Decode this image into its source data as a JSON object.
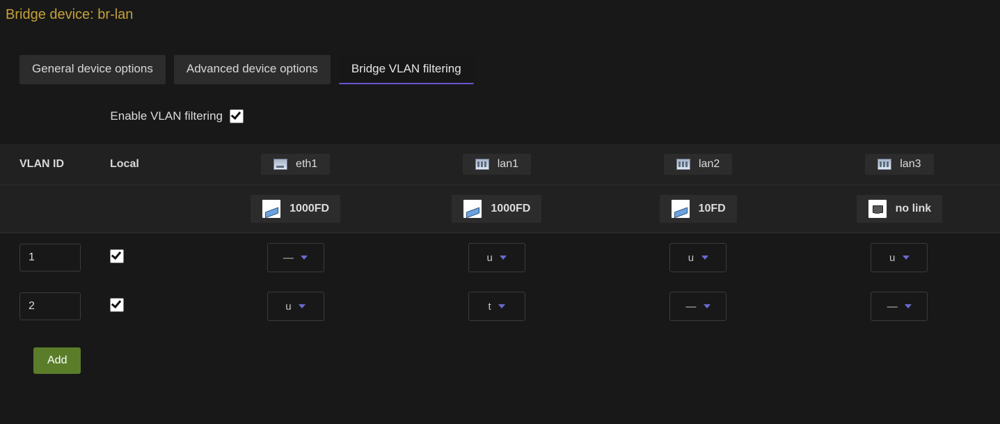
{
  "header": {
    "title": "Bridge device: br-lan"
  },
  "tabs": [
    {
      "label": "General device options",
      "active": false
    },
    {
      "label": "Advanced device options",
      "active": false
    },
    {
      "label": "Bridge VLAN filtering",
      "active": true
    }
  ],
  "vlan_filtering": {
    "enable_label": "Enable VLAN filtering",
    "enable_checked": true
  },
  "table": {
    "headers": {
      "vlan_id": "VLAN ID",
      "local": "Local"
    },
    "ports": [
      {
        "name": "eth1",
        "icon": "single",
        "link_speed": "1000FD",
        "link_up": true
      },
      {
        "name": "lan1",
        "icon": "multi",
        "link_speed": "1000FD",
        "link_up": true
      },
      {
        "name": "lan2",
        "icon": "multi",
        "link_speed": "10FD",
        "link_up": true
      },
      {
        "name": "lan3",
        "icon": "multi",
        "link_speed": "no link",
        "link_up": false
      }
    ],
    "rows": [
      {
        "vlan_id": "1",
        "local": true,
        "assign": [
          "—",
          "u",
          "u",
          "u"
        ]
      },
      {
        "vlan_id": "2",
        "local": true,
        "assign": [
          "u",
          "t",
          "—",
          "—"
        ]
      }
    ],
    "add_label": "Add"
  }
}
